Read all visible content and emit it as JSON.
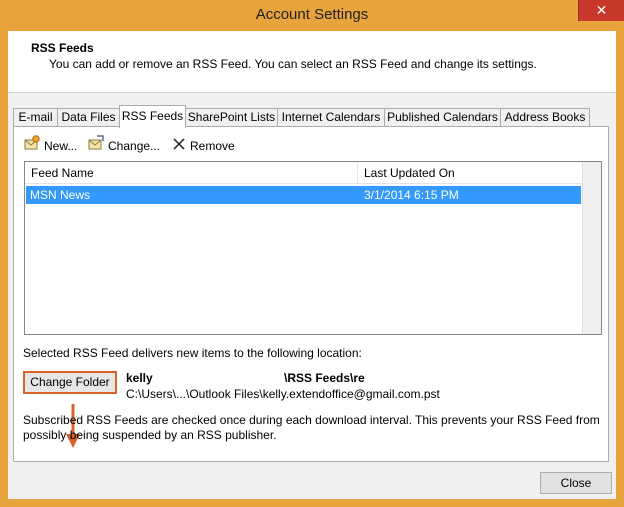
{
  "window": {
    "title": "Account Settings",
    "close_glyph": "✕"
  },
  "header": {
    "title": "RSS Feeds",
    "subtitle": "You can add or remove an RSS Feed. You can select an RSS Feed and change its settings."
  },
  "tabs": [
    {
      "label": "E-mail"
    },
    {
      "label": "Data Files"
    },
    {
      "label": "RSS Feeds"
    },
    {
      "label": "SharePoint Lists"
    },
    {
      "label": "Internet Calendars"
    },
    {
      "label": "Published Calendars"
    },
    {
      "label": "Address Books"
    }
  ],
  "active_tab": "RSS Feeds",
  "toolbar": {
    "new_label": "New...",
    "change_label": "Change...",
    "remove_label": "Remove"
  },
  "list": {
    "columns": [
      "Feed Name",
      "Last Updated On"
    ],
    "rows": [
      {
        "name": "MSN News",
        "updated": "3/1/2014 6:15 PM"
      }
    ]
  },
  "location": {
    "label": "Selected RSS Feed delivers new items to the following location:",
    "button_label": "Change Folder",
    "user": "kelly",
    "folder": "\\RSS Feeds\\re",
    "path": "C:\\Users\\...\\Outlook Files\\kelly.extendoffice@gmail.com.pst"
  },
  "info": "Subscribed RSS Feeds are checked once during each download interval. This prevents your RSS Feed from possibly being suspended by an RSS publisher.",
  "footer": {
    "close_label": "Close"
  },
  "colors": {
    "frame": "#e8a33d",
    "selection": "#3399ff",
    "annotation": "#d9622b"
  }
}
